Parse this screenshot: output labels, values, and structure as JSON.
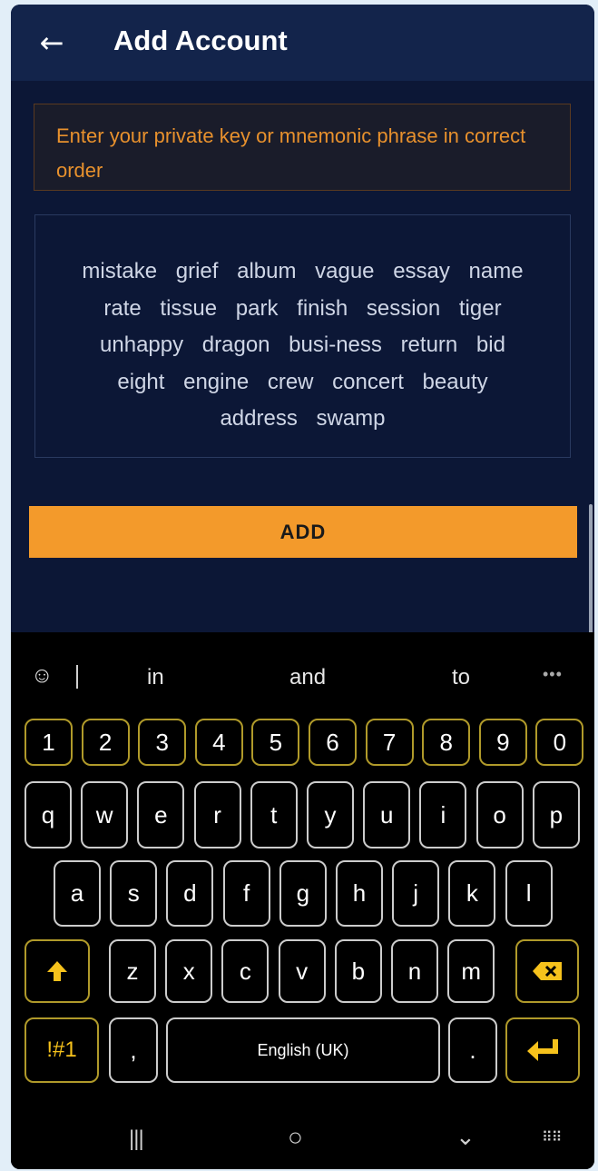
{
  "header": {
    "back_icon": "arrow-left-icon",
    "title": "Add Account"
  },
  "hint": {
    "text": "Enter your private key or mnemonic phrase in correct order"
  },
  "phrase": {
    "text": "mistake grief album vague essay name rate tissue park finish session tiger unhappy dragon busi-ness return bid eight engine crew concert beauty address swamp"
  },
  "add_button": {
    "label": "ADD"
  },
  "keyboard": {
    "emoji_icon": "emoji-icon",
    "suggestions": [
      "in",
      "and",
      "to"
    ],
    "more_icon": "more-dots-icon",
    "more_label": "•••",
    "number_row": [
      "1",
      "2",
      "3",
      "4",
      "5",
      "6",
      "7",
      "8",
      "9",
      "0"
    ],
    "row1": [
      "q",
      "w",
      "e",
      "r",
      "t",
      "y",
      "u",
      "i",
      "o",
      "p"
    ],
    "row2": [
      "a",
      "s",
      "d",
      "f",
      "g",
      "h",
      "j",
      "k",
      "l"
    ],
    "row3": [
      "z",
      "x",
      "c",
      "v",
      "b",
      "n",
      "m"
    ],
    "shift_icon": "shift-icon",
    "backspace_icon": "backspace-icon",
    "symbols_label": "!#1",
    "comma_label": ",",
    "space_label": "English (UK)",
    "period_label": ".",
    "enter_icon": "enter-icon"
  },
  "navbar": {
    "recents_icon": "recents-icon",
    "home_icon": "home-icon",
    "back_icon": "chevron-down-icon",
    "keyboard_icon": "keyboard-icon"
  },
  "colors": {
    "background": "#0c1736",
    "appbar": "#13244b",
    "accent": "#f39a2b",
    "hint_text": "#e8912d",
    "key_border": "#cccccc",
    "number_border": "#b09a2a",
    "special_key": "#f6c21c"
  }
}
